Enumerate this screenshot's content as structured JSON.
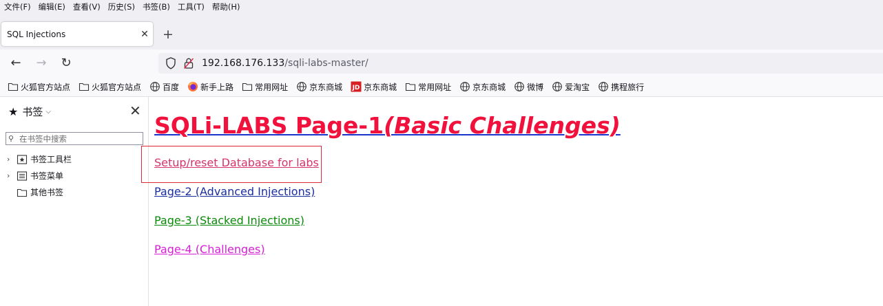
{
  "menu": [
    "文件(F)",
    "编辑(E)",
    "查看(V)",
    "历史(S)",
    "书签(B)",
    "工具(T)",
    "帮助(H)"
  ],
  "tab": {
    "title": "SQL Injections",
    "close": "✕"
  },
  "newtab": "+",
  "nav": {
    "back": "←",
    "forward": "→",
    "reload": "↻"
  },
  "url": {
    "host": "192.168.176.133",
    "path": "/sqli-labs-master/"
  },
  "bookmarks": [
    {
      "label": "火狐官方站点",
      "icon": "folder-icon"
    },
    {
      "label": "火狐官方站点",
      "icon": "folder-icon"
    },
    {
      "label": "百度",
      "icon": "globe-icon"
    },
    {
      "label": "新手上路",
      "icon": "firefox-icon"
    },
    {
      "label": "常用网址",
      "icon": "folder-icon"
    },
    {
      "label": "京东商城",
      "icon": "globe-icon"
    },
    {
      "label": "京东商城",
      "icon": "jd-icon"
    },
    {
      "label": "常用网址",
      "icon": "folder-icon"
    },
    {
      "label": "京东商城",
      "icon": "globe-icon"
    },
    {
      "label": "微博",
      "icon": "globe-icon"
    },
    {
      "label": "爱淘宝",
      "icon": "globe-icon"
    },
    {
      "label": "携程旅行",
      "icon": "globe-icon"
    }
  ],
  "sidebar": {
    "title": "书签",
    "close": "✕",
    "search_placeholder": "在书签中搜索",
    "items": [
      {
        "label": "书签工具栏",
        "twisty": "›"
      },
      {
        "label": "书签菜单",
        "twisty": "›"
      },
      {
        "label": "其他书签",
        "twisty": ""
      }
    ]
  },
  "page": {
    "heading_main": "SQLi-LABS Page-1",
    "heading_italic": "(Basic Challenges)",
    "links": [
      {
        "label": "Setup/reset Database for labs",
        "color": "#d6336c"
      },
      {
        "label": "Page-2 (Advanced Injections)",
        "color": "#1a2ea0"
      },
      {
        "label": "Page-3 (Stacked Injections)",
        "color": "#0a8a0a"
      },
      {
        "label": "Page-4 (Challenges)",
        "color": "#d61ed6"
      }
    ]
  },
  "colors": {
    "heading": "#f0123d",
    "heading_underline": "#1a33cc",
    "highlight_box": "#e0253a"
  }
}
